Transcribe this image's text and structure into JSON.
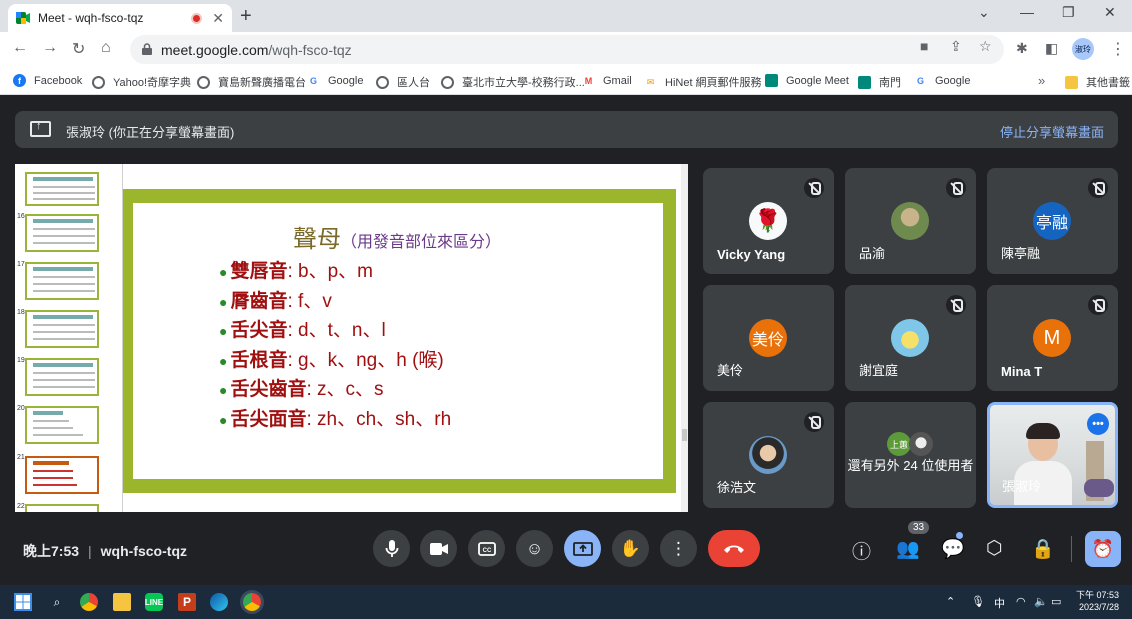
{
  "browser": {
    "tab_title": "Meet - wqh-fsco-tqz",
    "url_host": "meet.google.com",
    "url_path": "/wqh-fsco-tqz",
    "profile_label": "淑玲",
    "bookmarks": [
      {
        "label": "Facebook",
        "icon": "facebook-icon",
        "color": "#1877f2"
      },
      {
        "label": "Yahoo!奇摩字典",
        "icon": "globe-icon",
        "color": "#5f6368"
      },
      {
        "label": "寶島新聲廣播電台",
        "icon": "globe-icon",
        "color": "#5f6368"
      },
      {
        "label": "Google",
        "icon": "google-icon",
        "color": "#4285f4"
      },
      {
        "label": "區人台",
        "icon": "globe-icon",
        "color": "#5f6368"
      },
      {
        "label": "臺北市立大學-校務行政...",
        "icon": "globe-icon",
        "color": "#5f6368"
      },
      {
        "label": "Gmail",
        "icon": "gmail-icon",
        "color": "#ea4335"
      },
      {
        "label": "HiNet 網頁郵件服務",
        "icon": "mail-icon",
        "color": "#f29900"
      },
      {
        "label": "Google Meet",
        "icon": "meet-icon",
        "color": "#00897b"
      },
      {
        "label": "南門",
        "icon": "meet-icon",
        "color": "#00897b"
      },
      {
        "label": "Google",
        "icon": "google-icon",
        "color": "#4285f4"
      }
    ],
    "other_bookmarks": "其他書籤"
  },
  "meet": {
    "share_banner_text": "張淑玲 (你正在分享螢幕畫面)",
    "stop_sharing": "停止分享螢幕畫面",
    "slide": {
      "title": "聲母",
      "title_sub": "（用發音部位來區分）",
      "bullets": [
        {
          "label": "雙唇音",
          "value": ": b、p、m"
        },
        {
          "label": "脣齒音",
          "value": ": f、v"
        },
        {
          "label": "舌尖音",
          "value": ": d、t、n、l"
        },
        {
          "label": "舌根音",
          "value": ": g、k、ng、h (喉)"
        },
        {
          "label": "舌尖齒音",
          "value": ": z、c、s"
        },
        {
          "label": "舌尖面音",
          "value": ": zh、ch、sh、rh"
        }
      ],
      "thumb_numbers": [
        "16",
        "17",
        "18",
        "19",
        "20",
        "21",
        "22"
      ]
    },
    "participants": [
      {
        "name": "Vicky Yang",
        "avatar": "🌹",
        "avatar_bg": "#f8f9fa",
        "bold": true
      },
      {
        "name": "品渝",
        "avatar": "",
        "avatar_bg": "#8a9a6a",
        "bold": false
      },
      {
        "name": "陳亭融",
        "avatar": "亭融",
        "avatar_bg": "#1565c0",
        "bold": false
      },
      {
        "name": "美伶",
        "avatar": "美伶",
        "avatar_bg": "#e8710a",
        "bold": false
      },
      {
        "name": "謝宜庭",
        "avatar": "",
        "avatar_bg": "#7fc7e8",
        "bold": false
      },
      {
        "name": "Mina T",
        "avatar": "M",
        "avatar_bg": "#e8710a",
        "bold": true
      },
      {
        "name": "徐浩文",
        "avatar": "",
        "avatar_bg": "#6a7b8c",
        "bold": false
      }
    ],
    "others": {
      "text": "還有另外 24 位使用者",
      "chip1": "上蕙"
    },
    "self": {
      "name": "張淑玲"
    },
    "time": "晚上7:53",
    "meeting_code": "wqh-fsco-tqz",
    "participant_count": "33"
  },
  "taskbar": {
    "ime": "中",
    "time": "下午 07:53",
    "date": "2023/7/28"
  }
}
